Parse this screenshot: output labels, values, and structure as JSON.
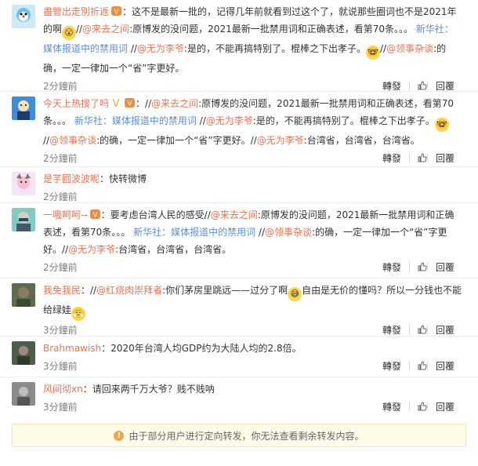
{
  "colors": {
    "user": "#eb7350",
    "link": "#5d8fd6",
    "meta": "#808080",
    "notice_bg": "#fefbe9"
  },
  "action_labels": {
    "repost": "轉發",
    "reply": "回覆",
    "like_icon": "thumb-up-icon"
  },
  "comments": [
    {
      "user": "盡管出走別折返",
      "segments": [
        {
          "t": "：这不是最新一批的，记得几年前就看到过这个了，就说那些圈词也不是2021年的啊"
        },
        {
          "t": "//",
          "c": ""
        },
        {
          "t": "@来去之间",
          "c": "user"
        },
        {
          "t": ":原博发的没问题，2021最新一批禁用词和正确表述，看第70条。。。"
        },
        {
          "t": " 新华社：媒体报道中的禁用词",
          "c": "blue"
        },
        {
          "t": " //"
        },
        {
          "t": "@无为李爷",
          "c": "user"
        },
        {
          "t": ":是的，不能再搞特别了。棍棒之下出孝子。"
        },
        {
          "t": "//"
        },
        {
          "t": "@领事杂谈",
          "c": "user"
        },
        {
          "t": ":的确，一定一律加一个“省”字更好。"
        }
      ],
      "time": "2分鐘前"
    },
    {
      "user": "今天上热搜了吗",
      "segments": [
        {
          "t": "："
        },
        {
          "t": "//"
        },
        {
          "t": "@来去之间",
          "c": "user"
        },
        {
          "t": ":原博发的没问题，2021最新一批禁用词和正确表述，看第70条。。。"
        },
        {
          "t": " 新华社：媒体报道中的禁用词",
          "c": "blue"
        },
        {
          "t": " //"
        },
        {
          "t": "@无为李爷",
          "c": "user"
        },
        {
          "t": ":是的，不能再搞特别了。棍棒之下出孝子。"
        },
        {
          "t": "//"
        },
        {
          "t": "@领事杂谈",
          "c": "user"
        },
        {
          "t": ":的确，一定一律加一个“省”字更好。//"
        },
        {
          "t": "@无为李爷",
          "c": "user"
        },
        {
          "t": ":台湾省，台湾省，台湾省。"
        }
      ],
      "time": "2分鐘前"
    },
    {
      "user": "是芋圆波波呢",
      "segments": [
        {
          "t": "：快转微博"
        }
      ],
      "time": "2分鐘前"
    },
    {
      "user": "一哦呵呵--",
      "segments": [
        {
          "t": "：要考虑台湾人民的感受//"
        },
        {
          "t": "@来去之间",
          "c": "user"
        },
        {
          "t": ":原博发的没问题，2021最新一批禁用词和正确表述，看第70条。。。"
        },
        {
          "t": " 新华社：媒体报道中的禁用词",
          "c": "blue"
        },
        {
          "t": " //"
        },
        {
          "t": "@领事杂谈",
          "c": "user"
        },
        {
          "t": ":的确，一定一律加一个“省”字更好。//"
        },
        {
          "t": "@无为李爷",
          "c": "user"
        },
        {
          "t": ":台湾省，台湾省，台湾省。"
        }
      ],
      "time": "2分鐘前"
    },
    {
      "user": "我免我民",
      "segments": [
        {
          "t": "：//"
        },
        {
          "t": "@红烧肉崇拜者",
          "c": "user"
        },
        {
          "t": ":你们茅房里跳远——过分了啊"
        },
        {
          "t": "自由是无价的懂吗？所以一分钱也不能给绿娃"
        }
      ],
      "time": "3分鐘前"
    },
    {
      "user": "Brahmawish",
      "segments": [
        {
          "t": "：2020年台湾人均GDP约为大陆人均的2.8倍。"
        }
      ],
      "time": "3分鐘前"
    },
    {
      "user": "风间彻xn",
      "segments": [
        {
          "t": "：请回来两千万大爷？贱不贱呐"
        }
      ],
      "time": "3分鐘前"
    }
  ],
  "notice": {
    "text": "由于部分用户进行定向转发，你无法查看剩余转发内容。",
    "icon": "warning-icon"
  }
}
